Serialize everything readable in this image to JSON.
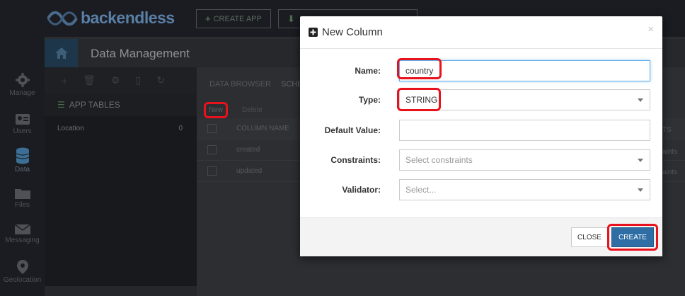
{
  "app": {
    "logo_text": "backendless"
  },
  "topbar": {
    "create_app_label": "CREATE APP"
  },
  "leftnav": {
    "items": [
      {
        "label": "Manage",
        "icon": "gear-icon"
      },
      {
        "label": "Users",
        "icon": "users-icon"
      },
      {
        "label": "Data",
        "icon": "database-icon"
      },
      {
        "label": "Files",
        "icon": "folder-icon"
      },
      {
        "label": "Messaging",
        "icon": "envelope-icon"
      },
      {
        "label": "Geolocation",
        "icon": "map-pin-icon"
      }
    ],
    "active": "Data"
  },
  "header": {
    "title": "Data Management"
  },
  "tables_panel": {
    "heading": "APP TABLES",
    "tables": [
      {
        "name": "Location",
        "count": "0"
      }
    ]
  },
  "content": {
    "tabs": [
      "DATA BROWSER",
      "SCHE"
    ],
    "actions": {
      "new_label": "New",
      "delete_label": "Delete"
    },
    "grid": {
      "header": "COLUMN NAME",
      "rows": [
        "created",
        "updated"
      ],
      "right_header_fragment": "TS",
      "right_row_fragment": "aints"
    }
  },
  "modal": {
    "title": "New Column",
    "fields": {
      "name": {
        "label": "Name:",
        "value": "country"
      },
      "type": {
        "label": "Type:",
        "value": "STRING"
      },
      "default": {
        "label": "Default Value:",
        "value": ""
      },
      "constraints": {
        "label": "Constraints:",
        "placeholder": "Select constraints"
      },
      "validator": {
        "label": "Validator:",
        "placeholder": "Select..."
      }
    },
    "buttons": {
      "close_label": "CLOSE",
      "create_label": "CREATE"
    }
  },
  "colors": {
    "accent": "#2f6ea5",
    "highlight": "#e8121c",
    "logo": "#5a7fa6"
  }
}
